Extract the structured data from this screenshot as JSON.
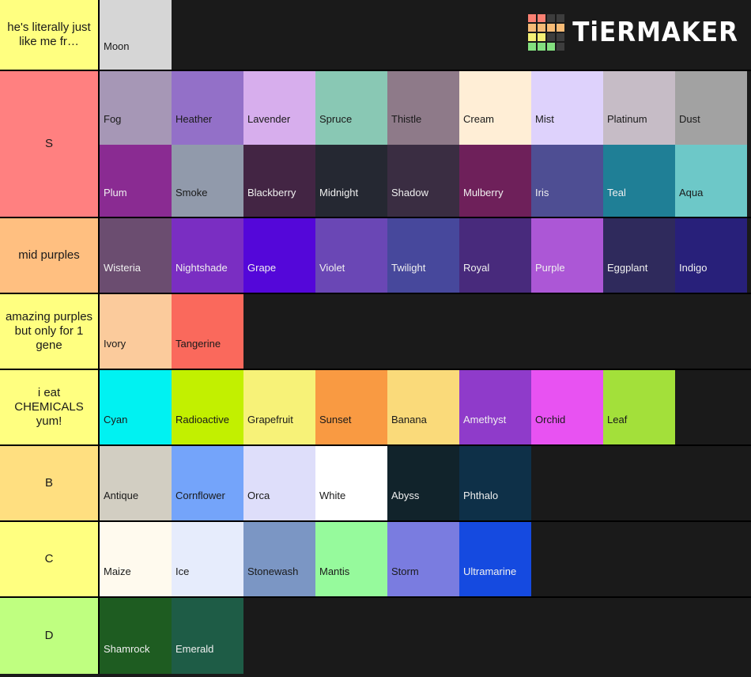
{
  "app": {
    "brand": "TiERMAKER",
    "logo_icon": "tiermaker-logo-icon",
    "background_color": "#1a1a1a",
    "logo_colors": [
      "#fa8072",
      "#fa8072",
      "#3d3d3d",
      "#3d3d3d",
      "#f7bb76",
      "#f7bb76",
      "#f7bb76",
      "#f7bb76",
      "#f4f075",
      "#f4f075",
      "#3d3d3d",
      "#3d3d3d",
      "#83e07f",
      "#83e07f",
      "#83e07f",
      "#3d3d3d"
    ]
  },
  "tiers": [
    {
      "label": "he's literally just like me fr…",
      "label_color": "#ffff80",
      "multiline": true,
      "height_class": "row-h90",
      "items": [
        {
          "name": "Moon",
          "color": "#d6d6d6",
          "text_color": "#1a1a1a"
        }
      ]
    },
    {
      "label": "S",
      "label_color": "#ff8080",
      "multiline": false,
      "height_class": "row-h186",
      "wrap": true,
      "items": [
        {
          "name": "Fog",
          "color": "#a697b6",
          "text_color": "#1a1a1a"
        },
        {
          "name": "Heather",
          "color": "#9370c8",
          "text_color": "#1a1a1a"
        },
        {
          "name": "Lavender",
          "color": "#d7aeed",
          "text_color": "#1a1a1a"
        },
        {
          "name": "Spruce",
          "color": "#89c8b4",
          "text_color": "#1a1a1a"
        },
        {
          "name": "Thistle",
          "color": "#8e7a89",
          "text_color": "#1a1a1a"
        },
        {
          "name": "Cream",
          "color": "#ffeed6",
          "text_color": "#1a1a1a"
        },
        {
          "name": "Mist",
          "color": "#ded2fc",
          "text_color": "#1a1a1a"
        },
        {
          "name": "Platinum",
          "color": "#c6bcc6",
          "text_color": "#1a1a1a"
        },
        {
          "name": "Dust",
          "color": "#a2a2a2",
          "text_color": "#1a1a1a"
        },
        {
          "name": "Plum",
          "color": "#8a2b92",
          "text_color": "#f0f0f0"
        },
        {
          "name": "Smoke",
          "color": "#919aab",
          "text_color": "#1a1a1a"
        },
        {
          "name": "Blackberry",
          "color": "#432544",
          "text_color": "#f0f0f0"
        },
        {
          "name": "Midnight",
          "color": "#252832",
          "text_color": "#f0f0f0"
        },
        {
          "name": "Shadow",
          "color": "#3a2d42",
          "text_color": "#f0f0f0"
        },
        {
          "name": "Mulberry",
          "color": "#6e205a",
          "text_color": "#f0f0f0"
        },
        {
          "name": "Iris",
          "color": "#4e4e93",
          "text_color": "#f0f0f0"
        },
        {
          "name": "Teal",
          "color": "#1f7f96",
          "text_color": "#f0f0f0"
        },
        {
          "name": "Aqua",
          "color": "#6dc8c8",
          "text_color": "#1a1a1a"
        }
      ]
    },
    {
      "label": "mid purples",
      "label_color": "#ffbf80",
      "multiline": false,
      "height_class": "row-h96",
      "items": [
        {
          "name": "Wisteria",
          "color": "#6b4d70",
          "text_color": "#f0f0f0"
        },
        {
          "name": "Nightshade",
          "color": "#7a2ec2",
          "text_color": "#f0f0f0"
        },
        {
          "name": "Grape",
          "color": "#5407d9",
          "text_color": "#f0f0f0"
        },
        {
          "name": "Violet",
          "color": "#6a47b5",
          "text_color": "#f0f0f0"
        },
        {
          "name": "Twilight",
          "color": "#47489c",
          "text_color": "#f0f0f0"
        },
        {
          "name": "Royal",
          "color": "#482a7c",
          "text_color": "#f0f0f0"
        },
        {
          "name": "Purple",
          "color": "#ac57d6",
          "text_color": "#f0f0f0"
        },
        {
          "name": "Eggplant",
          "color": "#2f2a5c",
          "text_color": "#f0f0f0"
        },
        {
          "name": "Indigo",
          "color": "#28207a",
          "text_color": "#f0f0f0"
        }
      ]
    },
    {
      "label": "amazing purples but only for 1 gene",
      "label_color": "#ffff80",
      "multiline": true,
      "height_class": "row-h96",
      "items": [
        {
          "name": "Ivory",
          "color": "#fbcb9c",
          "text_color": "#1a1a1a"
        },
        {
          "name": "Tangerine",
          "color": "#fa695c",
          "text_color": "#1a1a1a"
        }
      ]
    },
    {
      "label": "i eat CHEMICALS yum!",
      "label_color": "#ffff80",
      "multiline": true,
      "height_class": "row-h96",
      "items": [
        {
          "name": "Cyan",
          "color": "#00f2f2",
          "text_color": "#1a1a1a"
        },
        {
          "name": "Radioactive",
          "color": "#c2f000",
          "text_color": "#1a1a1a"
        },
        {
          "name": "Grapefruit",
          "color": "#f7f278",
          "text_color": "#1a1a1a"
        },
        {
          "name": "Sunset",
          "color": "#f99a42",
          "text_color": "#1a1a1a"
        },
        {
          "name": "Banana",
          "color": "#fada7a",
          "text_color": "#1a1a1a"
        },
        {
          "name": "Amethyst",
          "color": "#8f3bca",
          "text_color": "#f0f0f0"
        },
        {
          "name": "Orchid",
          "color": "#e852f2",
          "text_color": "#1a1a1a"
        },
        {
          "name": "Leaf",
          "color": "#a3e03a",
          "text_color": "#1a1a1a"
        }
      ]
    },
    {
      "label": "B",
      "label_color": "#ffdf80",
      "multiline": false,
      "height_class": "row-h96",
      "items": [
        {
          "name": "Antique",
          "color": "#d2cec2",
          "text_color": "#1a1a1a"
        },
        {
          "name": "Cornflower",
          "color": "#74a4fa",
          "text_color": "#1a1a1a"
        },
        {
          "name": "Orca",
          "color": "#dedefa",
          "text_color": "#1a1a1a"
        },
        {
          "name": "White",
          "color": "#ffffff",
          "text_color": "#1a1a1a"
        },
        {
          "name": "Abyss",
          "color": "#11232b",
          "text_color": "#f0f0f0"
        },
        {
          "name": "Phthalo",
          "color": "#0e3048",
          "text_color": "#f0f0f0"
        }
      ]
    },
    {
      "label": "C",
      "label_color": "#ffff80",
      "multiline": false,
      "height_class": "row-h96",
      "items": [
        {
          "name": "Maize",
          "color": "#fffaee",
          "text_color": "#1a1a1a"
        },
        {
          "name": "Ice",
          "color": "#e6ecfc",
          "text_color": "#1a1a1a"
        },
        {
          "name": "Stonewash",
          "color": "#7b96c4",
          "text_color": "#1a1a1a"
        },
        {
          "name": "Mantis",
          "color": "#96fa9c",
          "text_color": "#1a1a1a"
        },
        {
          "name": "Storm",
          "color": "#7a7ce0",
          "text_color": "#1a1a1a"
        },
        {
          "name": "Ultramarine",
          "color": "#154ae0",
          "text_color": "#f0f0f0"
        }
      ]
    },
    {
      "label": "D",
      "label_color": "#bfff80",
      "multiline": false,
      "height_class": "row-h96",
      "items": [
        {
          "name": "Shamrock",
          "color": "#1e5c21",
          "text_color": "#f0f0f0"
        },
        {
          "name": "Emerald",
          "color": "#1e5c46",
          "text_color": "#f0f0f0"
        }
      ]
    }
  ]
}
